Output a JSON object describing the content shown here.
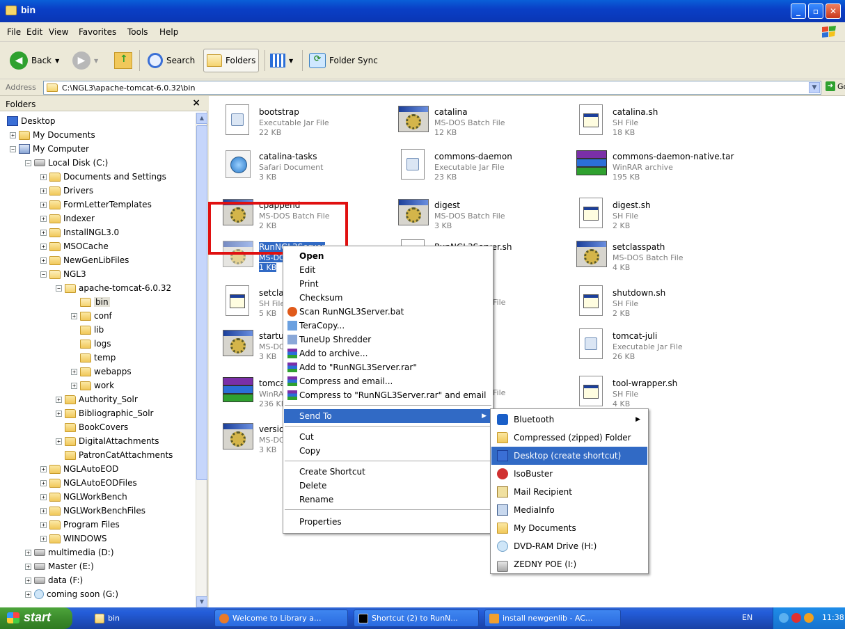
{
  "window": {
    "title": "bin"
  },
  "menu": [
    "File",
    "Edit",
    "View",
    "Favorites",
    "Tools",
    "Help"
  ],
  "toolbar": {
    "back": "Back",
    "search": "Search",
    "folders": "Folders",
    "sync": "Folder Sync"
  },
  "address": {
    "label": "Address",
    "path": "C:\\NGL3\\apache-tomcat-6.0.32\\bin",
    "go": "Go"
  },
  "folders_pane": {
    "header": "Folders",
    "close": "×",
    "tree": [
      "Desktop",
      "My Documents",
      "My Computer",
      "Local Disk (C:)",
      "Documents and Settings",
      "Drivers",
      "FormLetterTemplates",
      "Indexer",
      "InstallNGL3.0",
      "MSOCache",
      "NewGenLibFiles",
      "NGL3",
      "apache-tomcat-6.0.32",
      "bin",
      "conf",
      "lib",
      "logs",
      "temp",
      "webapps",
      "work",
      "Authority_Solr",
      "Bibliographic_Solr",
      "BookCovers",
      "DigitalAttachments",
      "PatronCatAttachments",
      "NGLAutoEOD",
      "NGLAutoEODFiles",
      "NGLWorkBench",
      "NGLWorkBenchFiles",
      "Program Files",
      "WINDOWS",
      "multimedia (D:)",
      "Master (E:)",
      "data (F:)",
      "coming soon (G:)"
    ]
  },
  "files": [
    {
      "name": "bootstrap",
      "type": "Executable Jar File",
      "size": "22 KB"
    },
    {
      "name": "catalina",
      "type": "MS-DOS Batch File",
      "size": "12 KB"
    },
    {
      "name": "catalina.sh",
      "type": "SH File",
      "size": "18 KB"
    },
    {
      "name": "catalina-tasks",
      "type": "Safari Document",
      "size": "3 KB"
    },
    {
      "name": "commons-daemon",
      "type": "Executable Jar File",
      "size": "23 KB"
    },
    {
      "name": "commons-daemon-native.tar",
      "type": "WinRAR archive",
      "size": "195 KB"
    },
    {
      "name": "cpappend",
      "type": "MS-DOS Batch File",
      "size": "2 KB"
    },
    {
      "name": "digest",
      "type": "MS-DOS Batch File",
      "size": "3 KB"
    },
    {
      "name": "digest.sh",
      "type": "SH File",
      "size": "2 KB"
    },
    {
      "name": "RunNGL3Server",
      "type": "MS-DO",
      "size": "1 KB"
    },
    {
      "name": "RunNGL3Server.sh",
      "type": "",
      "size": ""
    },
    {
      "name": "setclasspath",
      "type": "MS-DOS Batch File",
      "size": "4 KB"
    },
    {
      "name": "setclas",
      "type": "SH File",
      "size": "5 KB"
    },
    {
      "name": "",
      "type": "File",
      "size": ""
    },
    {
      "name": "shutdown.sh",
      "type": "SH File",
      "size": "2 KB"
    },
    {
      "name": "startup",
      "type": "MS-DO",
      "size": "3 KB"
    },
    {
      "name": "tomcat-juli",
      "type": "Executable Jar File",
      "size": "26 KB"
    },
    {
      "name": "tomcat",
      "type": "WinRA",
      "size": "236 KB"
    },
    {
      "name": "",
      "type": "File",
      "size": ""
    },
    {
      "name": "tool-wrapper.sh",
      "type": "SH File",
      "size": "4 KB"
    },
    {
      "name": "version",
      "type": "MS-DO",
      "size": "3 KB"
    }
  ],
  "context_menu": [
    "Open",
    "Edit",
    "Print",
    "Checksum",
    "Scan RunNGL3Server.bat",
    "TeraCopy...",
    "TuneUp Shredder",
    "Add to archive...",
    "Add to \"RunNGL3Server.rar\"",
    "Compress and email...",
    "Compress to \"RunNGL3Server.rar\" and email",
    "Send To",
    "Cut",
    "Copy",
    "Create Shortcut",
    "Delete",
    "Rename",
    "Properties"
  ],
  "send_to": [
    "Bluetooth",
    "Compressed (zipped) Folder",
    "Desktop (create shortcut)",
    "IsoBuster",
    "Mail Recipient",
    "MediaInfo",
    "My Documents",
    "DVD-RAM Drive (H:)",
    "ZEDNY POE (I:)"
  ],
  "taskbar": {
    "start": "start",
    "tasks": [
      "bin",
      "Welcome to Library a...",
      "Shortcut (2) to RunN...",
      "install newgenlib - AC..."
    ],
    "lang": "EN",
    "time": "11:38"
  }
}
